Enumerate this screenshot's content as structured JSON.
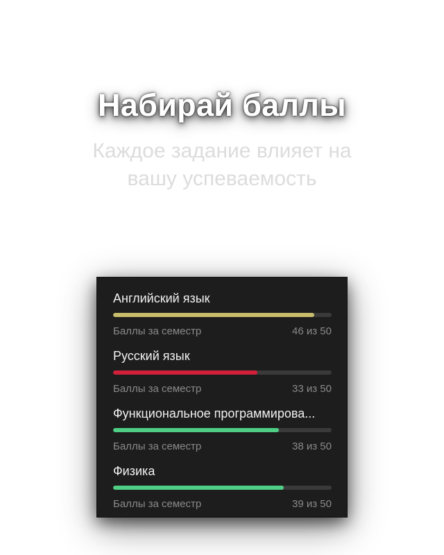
{
  "hero": {
    "title": "Набирай баллы",
    "subtitle": "Каждое задание влияет на вашу успеваемость"
  },
  "subjects": [
    {
      "name": "Английский язык",
      "caption": "Баллы за семестр",
      "score_text": "46 из 50",
      "score": 46,
      "max": 50,
      "color": "#c9bd6c"
    },
    {
      "name": "Русский язык",
      "caption": "Баллы за семестр",
      "score_text": "33 из 50",
      "score": 33,
      "max": 50,
      "color": "#d3203a"
    },
    {
      "name": "Функциональное программирова...",
      "caption": "Баллы за семестр",
      "score_text": "38 из 50",
      "score": 38,
      "max": 50,
      "color": "#4fcf85"
    },
    {
      "name": "Физика",
      "caption": "Баллы за семестр",
      "score_text": "39 из 50",
      "score": 39,
      "max": 50,
      "color": "#4fcf85"
    }
  ]
}
